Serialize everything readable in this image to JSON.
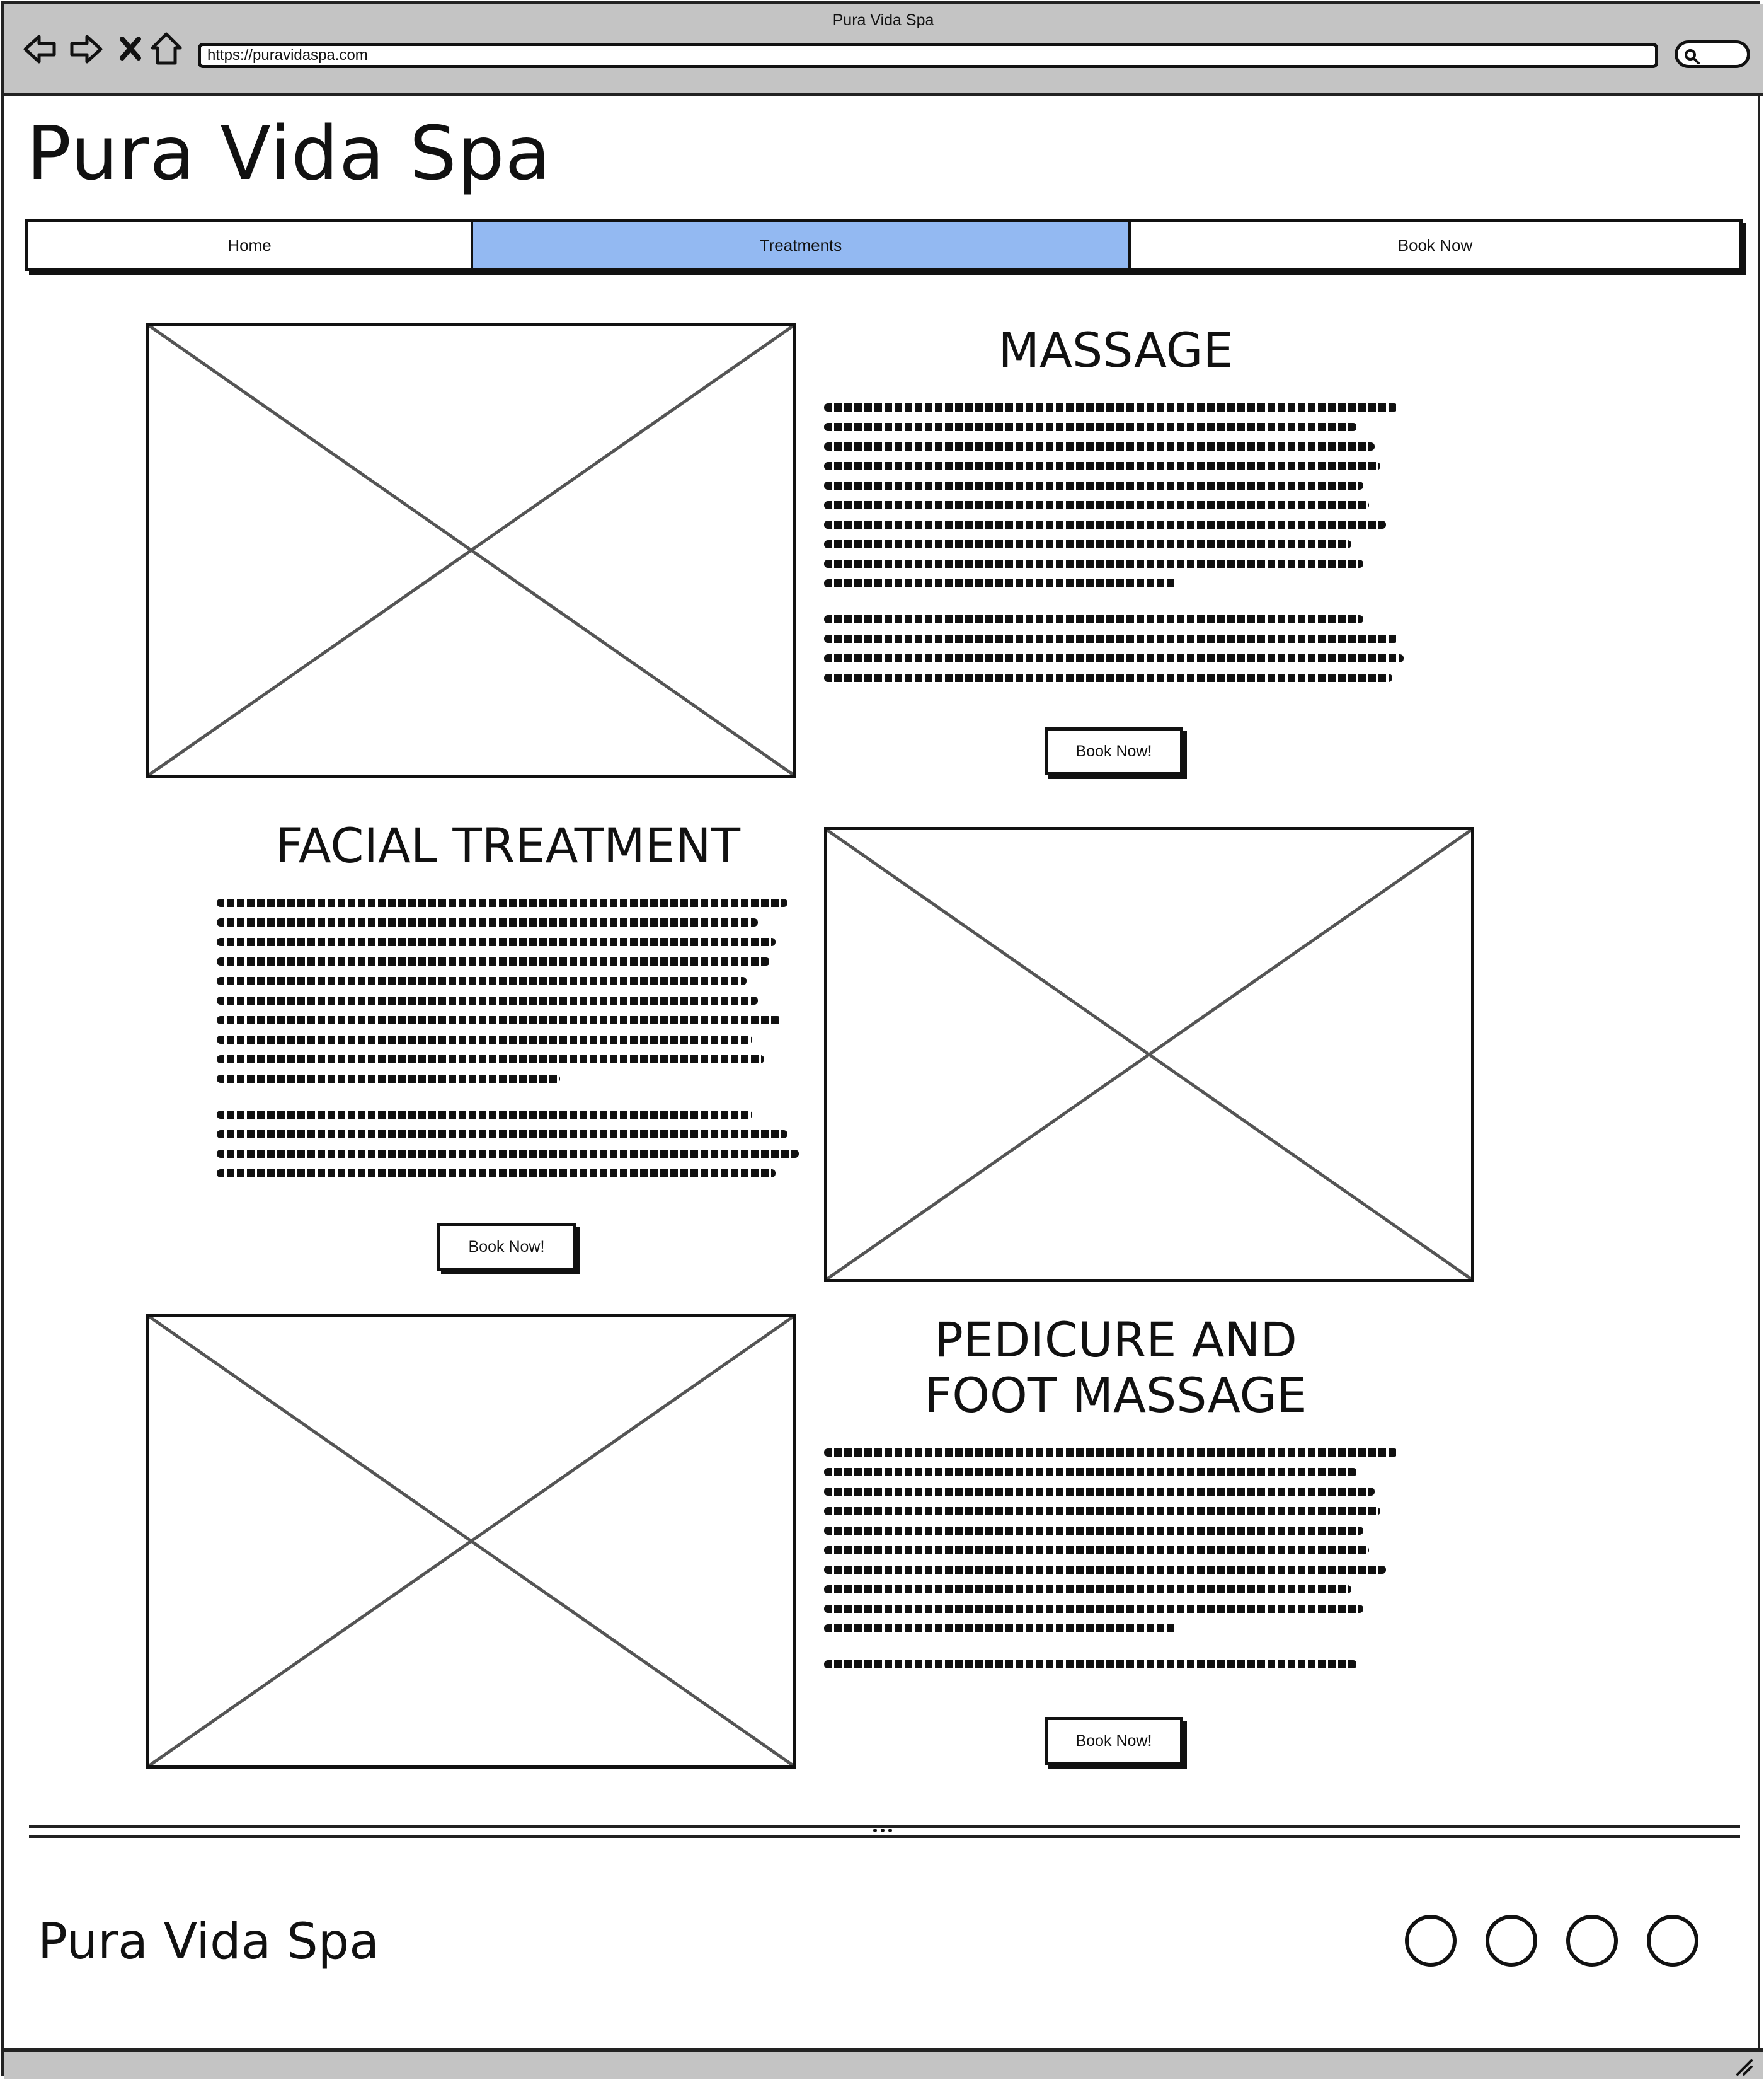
{
  "window": {
    "title": "Pura Vida Spa",
    "url": "https://puravidaspa.com"
  },
  "browser_icons": [
    "back-arrow-icon",
    "forward-arrow-icon",
    "close-x-icon",
    "home-icon",
    "search-icon"
  ],
  "site": {
    "title": "Pura Vida Spa"
  },
  "nav": {
    "items": [
      {
        "label": "Home",
        "active": false
      },
      {
        "label": "Treatments",
        "active": true
      },
      {
        "label": "Book Now",
        "active": false
      }
    ],
    "active_color": "#93b9f2"
  },
  "sections": [
    {
      "heading": "MASSAGE",
      "button": "Book Now!"
    },
    {
      "heading": "FACIAL TREATMENT",
      "button": "Book Now!"
    },
    {
      "heading_line1": "PEDICURE AND",
      "heading_line2": "FOOT MASSAGE",
      "button": "Book Now!"
    }
  ],
  "footer": {
    "title": "Pura Vida Spa",
    "social_icon_count": 4
  },
  "colors": {
    "chrome": "#c4c4c4",
    "ink": "#111111"
  }
}
